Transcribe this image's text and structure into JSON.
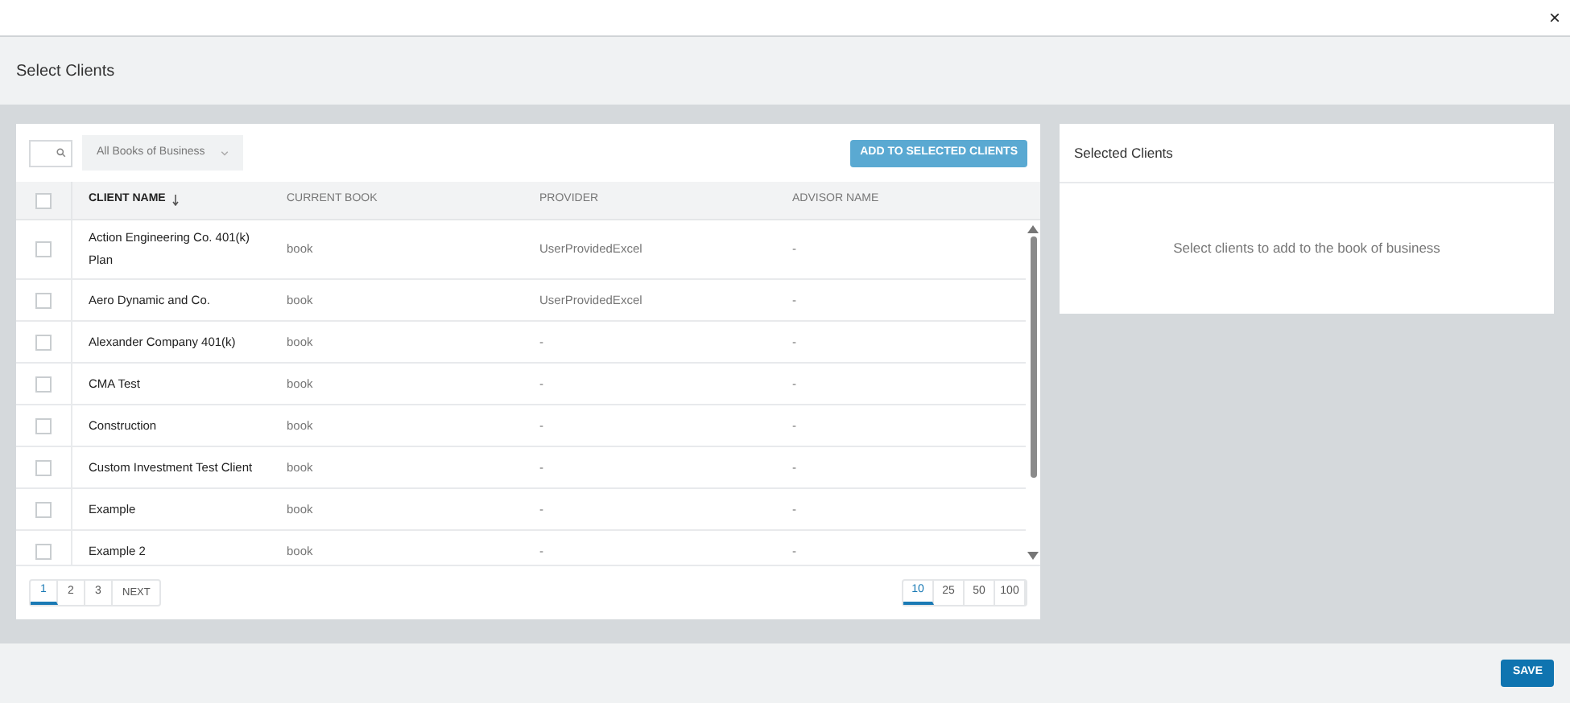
{
  "window": {
    "close": "×"
  },
  "header": {
    "title": "Select Clients"
  },
  "toolbar": {
    "book_filter": "All Books of Business",
    "add_button": "ADD TO SELECTED CLIENTS"
  },
  "table": {
    "select_all": {
      "checked": false
    },
    "columns": [
      {
        "label": "CLIENT NAME",
        "sorted": true
      },
      {
        "label": "CURRENT BOOK",
        "sorted": false
      },
      {
        "label": "PROVIDER",
        "sorted": false
      },
      {
        "label": "ADVISOR NAME",
        "sorted": false
      }
    ],
    "rows": [
      {
        "checked": false,
        "cells": [
          "Action Engineering Co. 401(k) Plan",
          "book",
          "UserProvidedExcel",
          "-"
        ]
      },
      {
        "checked": false,
        "cells": [
          "Aero Dynamic and Co.",
          "book",
          "UserProvidedExcel",
          "-"
        ]
      },
      {
        "checked": false,
        "cells": [
          "Alexander Company 401(k)",
          "book",
          "-",
          "-"
        ]
      },
      {
        "checked": false,
        "cells": [
          "CMA Test",
          "book",
          "-",
          "-"
        ]
      },
      {
        "checked": false,
        "cells": [
          "Construction",
          "book",
          "-",
          "-"
        ]
      },
      {
        "checked": false,
        "cells": [
          "Custom Investment Test Client",
          "book",
          "-",
          "-"
        ]
      },
      {
        "checked": false,
        "cells": [
          "Example",
          "book",
          "-",
          "-"
        ]
      },
      {
        "checked": false,
        "cells": [
          "Example 2",
          "book",
          "-",
          "-"
        ]
      }
    ]
  },
  "pagination": {
    "pages": [
      {
        "label": "1",
        "selected": true
      },
      {
        "label": "2",
        "selected": false
      },
      {
        "label": "3",
        "selected": false
      }
    ],
    "next": "NEXT",
    "page_sizes": [
      {
        "label": "10",
        "selected": true
      },
      {
        "label": "25",
        "selected": false
      },
      {
        "label": "50",
        "selected": false
      },
      {
        "label": "100",
        "selected": false
      }
    ]
  },
  "selected_panel": {
    "title": "Selected Clients",
    "empty_message": "Select clients to add to the book of business"
  },
  "footer": {
    "save": "SAVE"
  }
}
